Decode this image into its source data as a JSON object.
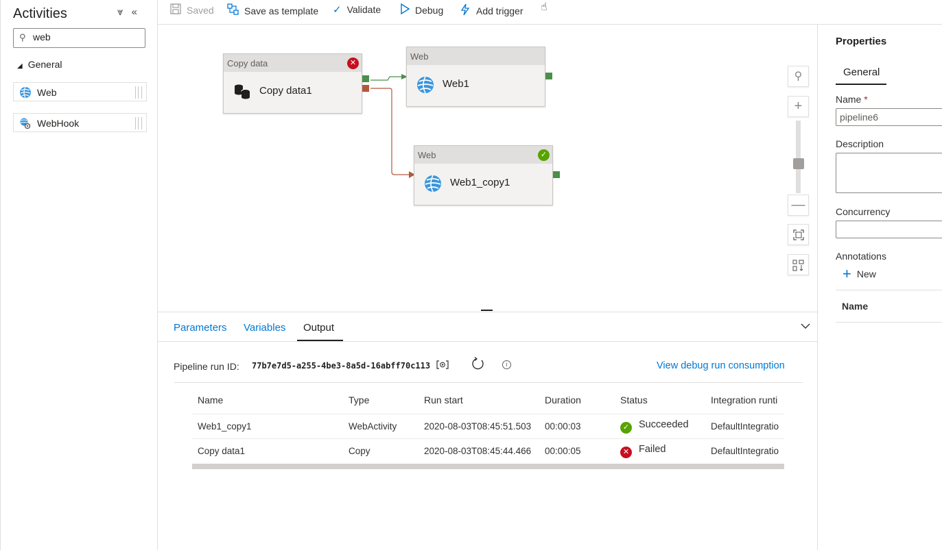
{
  "activities": {
    "title": "Activities",
    "search_value": "web",
    "section_label": "General",
    "items": [
      {
        "label": "Web",
        "icon": "web-activity-icon"
      },
      {
        "label": "WebHook",
        "icon": "webhook-icon"
      }
    ]
  },
  "toolbar": {
    "saved": "Saved",
    "save_template": "Save as template",
    "validate": "Validate",
    "debug": "Debug",
    "add_trigger": "Add trigger"
  },
  "canvas": {
    "nodes": [
      {
        "header": "Copy data",
        "label": "Copy data1",
        "status": "failed"
      },
      {
        "header": "Web",
        "label": "Web1",
        "status": "none"
      },
      {
        "header": "Web",
        "label": "Web1_copy1",
        "status": "succeeded"
      }
    ]
  },
  "output": {
    "tabs": [
      "Parameters",
      "Variables",
      "Output"
    ],
    "active_tab": "Output",
    "run_id_label": "Pipeline run ID:",
    "run_id": "77b7e7d5-a255-4be3-8a5d-16abff70c113",
    "consumption_link": "View debug run consumption",
    "columns": [
      "Name",
      "Type",
      "Run start",
      "Duration",
      "Status",
      "Integration runti"
    ],
    "rows": [
      {
        "name": "Web1_copy1",
        "type": "WebActivity",
        "run_start": "2020-08-03T08:45:51.503",
        "duration": "00:00:03",
        "status": "Succeeded",
        "integration": "DefaultIntegratio"
      },
      {
        "name": "Copy data1",
        "type": "Copy",
        "run_start": "2020-08-03T08:45:44.466",
        "duration": "00:00:05",
        "status": "Failed",
        "integration": "DefaultIntegratio"
      }
    ]
  },
  "properties": {
    "title": "Properties",
    "tab": "General",
    "name_label": "Name",
    "name_required": "*",
    "name_value": "pipeline6",
    "description_label": "Description",
    "concurrency_label": "Concurrency",
    "annotations_label": "Annotations",
    "new_label": "New",
    "annotations_col": "Name"
  },
  "colors": {
    "accent": "#0078d4",
    "success": "#57a300",
    "failure": "#c50f1f",
    "port_green": "#4b8f4b",
    "port_red": "#b0593b"
  }
}
